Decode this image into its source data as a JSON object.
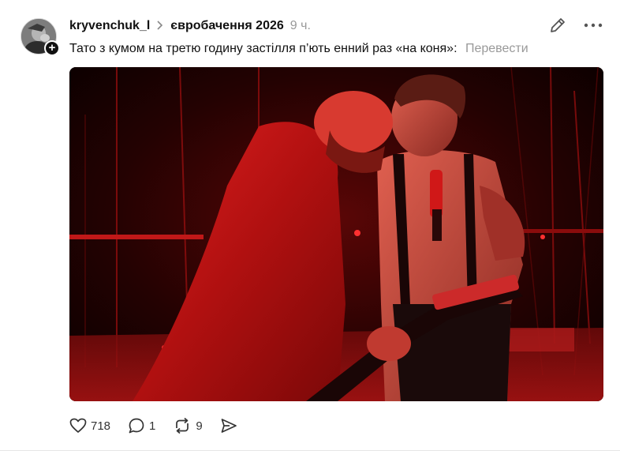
{
  "post": {
    "author": {
      "username": "kryvenchuk_l",
      "avatar_icon": "user-avatar",
      "follow_icon": "plus-icon"
    },
    "topic": "євробачення 2026",
    "time": "9 ч.",
    "caption": "Тато з кумом на третю годину застілля п’ють енний раз «на коня»:",
    "translate_label": "Перевести",
    "media": {
      "kind": "photo",
      "description_icon": "stage-performance-photo"
    },
    "stats": {
      "likes": "718",
      "comments": "1",
      "reposts": "9"
    },
    "icons": {
      "edit": "pencil-icon",
      "more": "more-icon",
      "like": "heart-icon",
      "comment": "comment-icon",
      "repost": "repost-icon",
      "share": "share-icon"
    },
    "colors": {
      "text": "#111111",
      "muted": "#999999",
      "stage_red": "#d01818"
    }
  }
}
